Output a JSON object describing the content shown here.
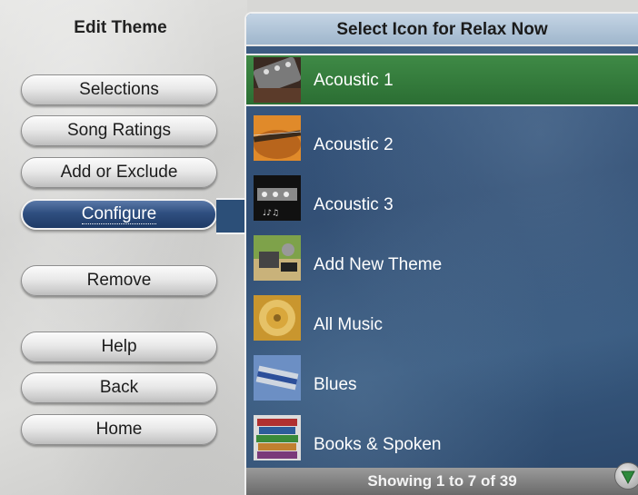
{
  "left": {
    "title": "Edit Theme",
    "buttons": [
      {
        "label": "Selections"
      },
      {
        "label": "Song Ratings"
      },
      {
        "label": "Add or Exclude"
      },
      {
        "label": "Configure"
      },
      {
        "label": "Remove"
      },
      {
        "label": "Help"
      },
      {
        "label": "Back"
      },
      {
        "label": "Home"
      }
    ],
    "active_button": "Configure"
  },
  "right": {
    "title": "Select Icon for Relax Now",
    "items": [
      {
        "label": "Acoustic 1",
        "icon": "guitar-headstock-icon"
      },
      {
        "label": "Acoustic 2",
        "icon": "acoustic-guitar-icon"
      },
      {
        "label": "Acoustic 3",
        "icon": "guitar-headstock-icon"
      },
      {
        "label": "Add New Theme",
        "icon": "music-equipment-icon"
      },
      {
        "label": "All Music",
        "icon": "cd-disc-icon"
      },
      {
        "label": "Blues",
        "icon": "harmonica-icon"
      },
      {
        "label": "Books & Spoken",
        "icon": "books-stack-icon"
      }
    ],
    "selected_item": "Acoustic 1",
    "footer": "Showing 1 to 7 of 39"
  },
  "colors": {
    "selected_row": "#3f8a46",
    "active_button": "#2f4f80",
    "list_background": "#2d4a70"
  }
}
